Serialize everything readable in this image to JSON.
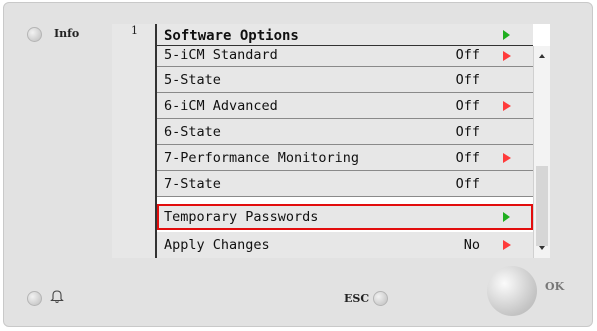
{
  "info_label": "Info",
  "esc_label": "ESC",
  "ok_label": "OK",
  "line_number": "1",
  "menu": {
    "title": "Software Options",
    "title_arrow": "green",
    "rows": [
      {
        "name": "5-iCM Standard",
        "value": "Off",
        "arrow": "red"
      },
      {
        "name": "5-State",
        "value": "Off",
        "arrow": ""
      },
      {
        "name": "6-iCM Advanced",
        "value": "Off",
        "arrow": "red"
      },
      {
        "name": "6-State",
        "value": "Off",
        "arrow": ""
      },
      {
        "name": "7-Performance Monitoring",
        "value": "Off",
        "arrow": "red"
      },
      {
        "name": "7-State",
        "value": "Off",
        "arrow": ""
      },
      {
        "name": "Temporary Passwords",
        "value": "",
        "arrow": "green",
        "selected": true
      },
      {
        "name": "Apply Changes",
        "value": "No",
        "arrow": "red"
      }
    ]
  },
  "icons": {
    "info_button": "round-button-icon",
    "alarm": "bell-icon",
    "esc_button": "round-button-icon",
    "scroll_up": "chevron-up-icon",
    "scroll_down": "chevron-down-icon"
  },
  "colors": {
    "selection_border": "#e20d0d",
    "red_arrow": "#ff3b3b",
    "green_arrow": "#1fae1f"
  }
}
